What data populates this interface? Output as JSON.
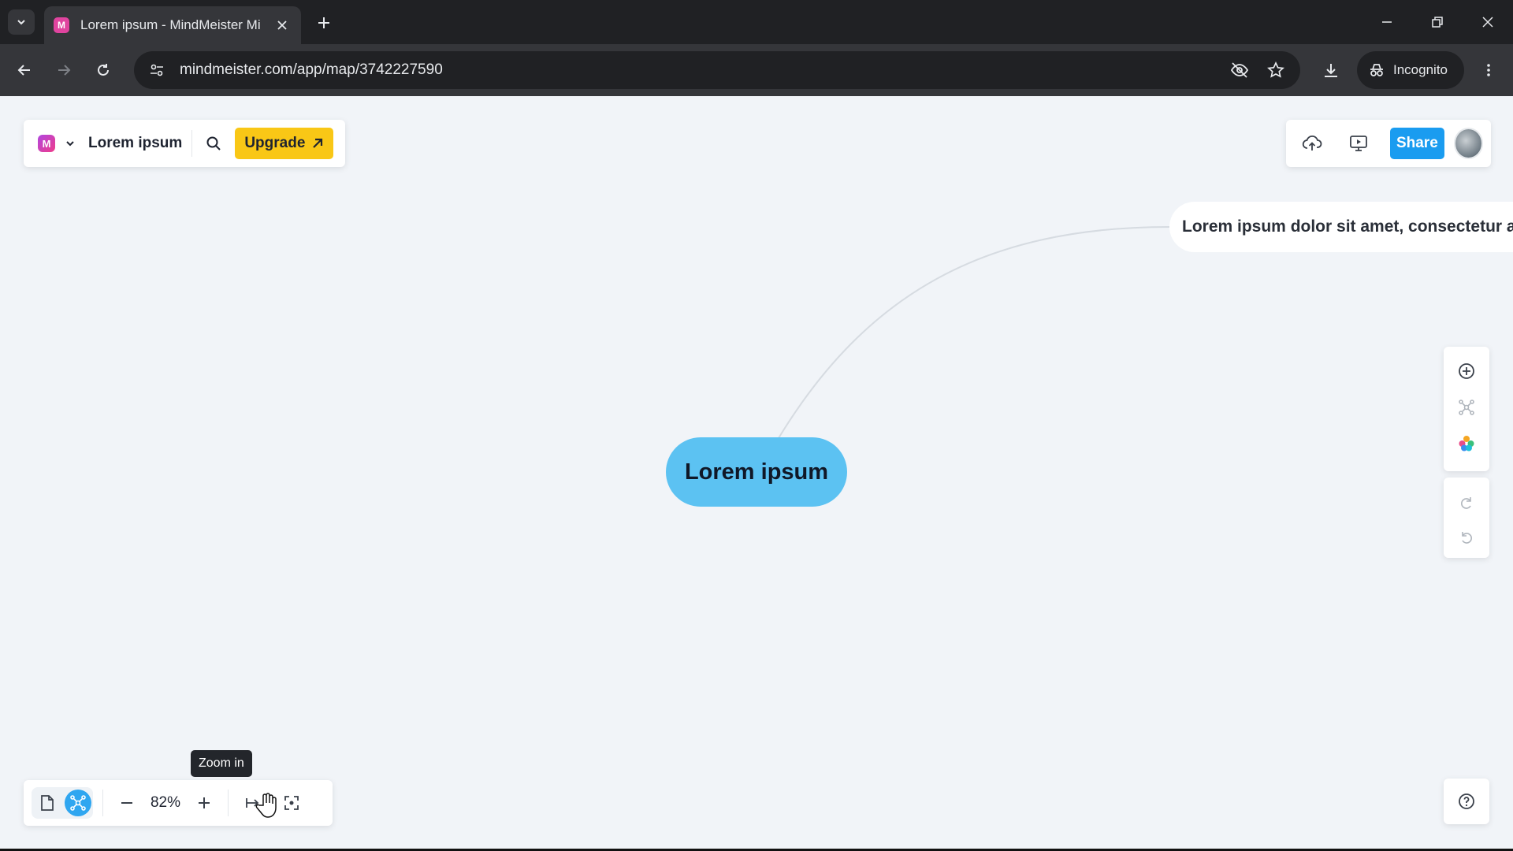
{
  "browser": {
    "tab_title": "Lorem ipsum - MindMeister Mi",
    "tab_favicon_letter": "M",
    "url": "mindmeister.com/app/map/3742227590",
    "incognito_label": "Incognito"
  },
  "app": {
    "logo_letter": "M",
    "map_title": "Lorem ipsum",
    "upgrade_label": "Upgrade",
    "share_label": "Share",
    "zoom_level": "82%",
    "tooltip": "Zoom in"
  },
  "mindmap": {
    "root_label": "Lorem ipsum",
    "child_label": "Lorem ipsum dolor sit amet, consectetur a"
  },
  "colors": {
    "root_node": "#5cc2f2",
    "upgrade": "#f9c716",
    "share": "#1a9cf0",
    "canvas": "#f1f4f8"
  },
  "icons": {
    "top_right": [
      "cloud-upload-icon",
      "present-icon"
    ],
    "right_tools": [
      "add-circle-icon",
      "layout-icon",
      "palette-icon",
      "redo-icon",
      "undo-icon"
    ],
    "bottom_left": [
      "outline-view-icon",
      "mindmap-view-icon",
      "zoom-out-icon",
      "zoom-in-icon",
      "fit-icon",
      "focus-icon"
    ]
  }
}
